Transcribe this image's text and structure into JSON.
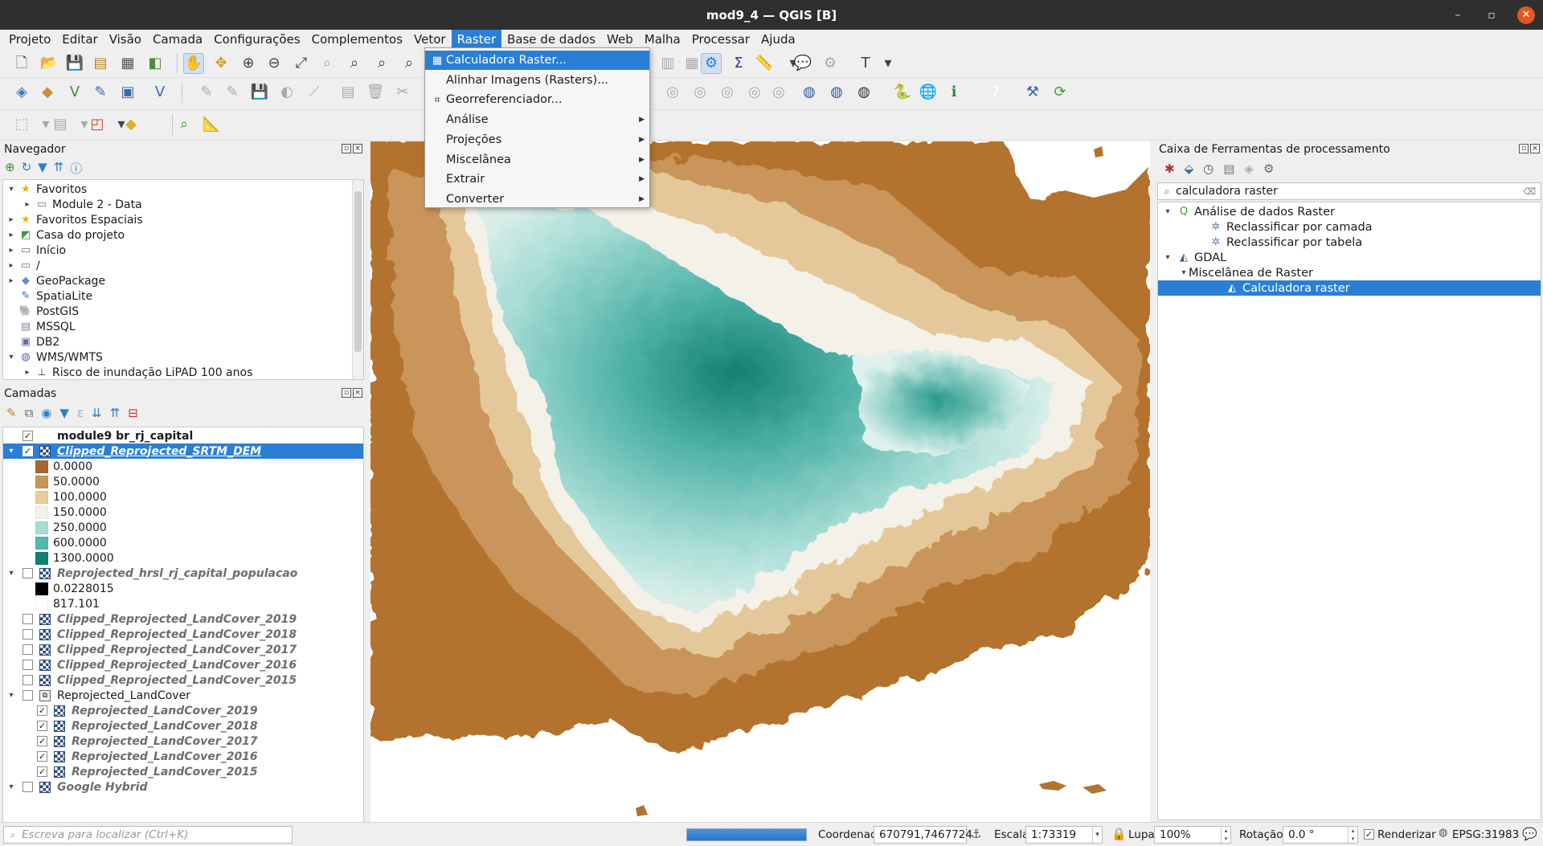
{
  "window": {
    "title": "mod9_4 — QGIS [B]",
    "minimize": "–",
    "maximize": "▫",
    "close": "✕"
  },
  "menubar": [
    "Projeto",
    "Editar",
    "Visão",
    "Camada",
    "Configurações",
    "Complementos",
    "Vetor",
    "Raster",
    "Base de dados",
    "Web",
    "Malha",
    "Processar",
    "Ajuda"
  ],
  "active_menu": "Raster",
  "raster_menu": [
    {
      "label": "Calculadora Raster...",
      "icon": "calculator-icon",
      "glyph": "▦",
      "submenu": false
    },
    {
      "label": "Alinhar Imagens (Rasters)...",
      "icon": "",
      "glyph": "",
      "submenu": false
    },
    {
      "label": "Georreferenciador...",
      "icon": "georeferencer-icon",
      "glyph": "⌗",
      "submenu": false
    },
    {
      "label": "Análise",
      "icon": "",
      "glyph": "",
      "submenu": true
    },
    {
      "label": "Projeções",
      "icon": "",
      "glyph": "",
      "submenu": true
    },
    {
      "label": "Miscelânea",
      "icon": "",
      "glyph": "",
      "submenu": true
    },
    {
      "label": "Extrair",
      "icon": "",
      "glyph": "",
      "submenu": true
    },
    {
      "label": "Converter",
      "icon": "",
      "glyph": "",
      "submenu": true
    }
  ],
  "navigator": {
    "title": "Navegador",
    "items": [
      {
        "label": "Favoritos",
        "caret": "▾",
        "icon": "star-icon",
        "glyph": "★",
        "color": "#e8b400"
      },
      {
        "label": "Module 2 - Data",
        "caret": "▸",
        "icon": "folder-icon",
        "glyph": "▭",
        "color": "#777777",
        "indent": 1
      },
      {
        "label": "Favoritos Espaciais",
        "caret": "▸",
        "icon": "star-icon",
        "glyph": "★",
        "color": "#e8b400"
      },
      {
        "label": "Casa do projeto",
        "caret": "▸",
        "icon": "project-home-icon",
        "glyph": "◩",
        "color": "#3a9b3a"
      },
      {
        "label": "Início",
        "caret": "▸",
        "icon": "folder-icon",
        "glyph": "▭",
        "color": "#777777"
      },
      {
        "label": "/",
        "caret": "▸",
        "icon": "folder-icon",
        "glyph": "▭",
        "color": "#777777"
      },
      {
        "label": "GeoPackage",
        "caret": "▸",
        "icon": "geopackage-icon",
        "glyph": "◆",
        "color": "#5f8fd1"
      },
      {
        "label": "SpatiaLite",
        "caret": "",
        "icon": "spatialite-icon",
        "glyph": "✎",
        "color": "#3466b5"
      },
      {
        "label": "PostGIS",
        "caret": "",
        "icon": "postgis-icon",
        "glyph": "🐘",
        "color": "#3b6aa0"
      },
      {
        "label": "MSSQL",
        "caret": "",
        "icon": "mssql-icon",
        "glyph": "▤",
        "color": "#7a8aa0"
      },
      {
        "label": "DB2",
        "caret": "",
        "icon": "db2-icon",
        "glyph": "▣",
        "color": "#5a6f9a"
      },
      {
        "label": "WMS/WMTS",
        "caret": "▾",
        "icon": "globe-icon",
        "glyph": "◍",
        "color": "#4a6ca0"
      },
      {
        "label": "Risco de inundação LiPAD 100 anos",
        "caret": "▸",
        "icon": "wms-layer-icon",
        "glyph": "⟂",
        "color": "#555555",
        "indent": 1
      }
    ]
  },
  "layers": {
    "title": "Camadas",
    "items": [
      {
        "type": "layer",
        "label": "module9 br_rj_capital",
        "checked": true,
        "caret": "",
        "icon": "none",
        "style": "bold",
        "indent": 0
      },
      {
        "type": "layer",
        "label": "Clipped_Reprojected_SRTM_DEM",
        "checked": true,
        "caret": "▾",
        "icon": "raster",
        "style": "it",
        "indent": 0,
        "selected": true
      },
      {
        "type": "legend",
        "label": "0.0000",
        "color": "#a9662a"
      },
      {
        "type": "legend",
        "label": "50.0000",
        "color": "#c69656"
      },
      {
        "type": "legend",
        "label": "100.0000",
        "color": "#e8cc98"
      },
      {
        "type": "legend",
        "label": "150.0000",
        "color": "#f3f1e8"
      },
      {
        "type": "legend",
        "label": "250.0000",
        "color": "#a6dcd5"
      },
      {
        "type": "legend",
        "label": "600.0000",
        "color": "#56b6ab"
      },
      {
        "type": "legend",
        "label": "1300.0000",
        "color": "#128070"
      },
      {
        "type": "layer",
        "label": "Reprojected_hrsl_rj_capital_populacao",
        "checked": false,
        "caret": "▾",
        "icon": "raster",
        "style": "it",
        "indent": 0
      },
      {
        "type": "legend",
        "label": "0.0228015",
        "color": "#000000"
      },
      {
        "type": "legend",
        "label": "817.101",
        "color": "#ffffff"
      },
      {
        "type": "layer",
        "label": "Clipped_Reprojected_LandCover_2019",
        "checked": false,
        "caret": "",
        "icon": "raster",
        "style": "it",
        "indent": 0
      },
      {
        "type": "layer",
        "label": "Clipped_Reprojected_LandCover_2018",
        "checked": false,
        "caret": "",
        "icon": "raster",
        "style": "it",
        "indent": 0
      },
      {
        "type": "layer",
        "label": "Clipped_Reprojected_LandCover_2017",
        "checked": false,
        "caret": "",
        "icon": "raster",
        "style": "it",
        "indent": 0
      },
      {
        "type": "layer",
        "label": "Clipped_Reprojected_LandCover_2016",
        "checked": false,
        "caret": "",
        "icon": "raster",
        "style": "it",
        "indent": 0
      },
      {
        "type": "layer",
        "label": "Clipped_Reprojected_LandCover_2015",
        "checked": false,
        "caret": "",
        "icon": "raster",
        "style": "it",
        "indent": 0
      },
      {
        "type": "layer",
        "label": "Reprojected_LandCover",
        "checked": false,
        "caret": "▾",
        "icon": "group",
        "style": "",
        "indent": 0
      },
      {
        "type": "layer",
        "label": "Reprojected_LandCover_2019",
        "checked": true,
        "caret": "",
        "icon": "raster",
        "style": "it",
        "indent": 1
      },
      {
        "type": "layer",
        "label": "Reprojected_LandCover_2018",
        "checked": true,
        "caret": "",
        "icon": "raster",
        "style": "it",
        "indent": 1
      },
      {
        "type": "layer",
        "label": "Reprojected_LandCover_2017",
        "checked": true,
        "caret": "",
        "icon": "raster",
        "style": "it",
        "indent": 1
      },
      {
        "type": "layer",
        "label": "Reprojected_LandCover_2016",
        "checked": true,
        "caret": "",
        "icon": "raster",
        "style": "it",
        "indent": 1
      },
      {
        "type": "layer",
        "label": "Reprojected_LandCover_2015",
        "checked": true,
        "caret": "",
        "icon": "raster",
        "style": "it",
        "indent": 1
      },
      {
        "type": "layer",
        "label": "Google Hybrid",
        "checked": false,
        "caret": "▾",
        "icon": "raster",
        "style": "it",
        "indent": 0
      }
    ]
  },
  "processing": {
    "title": "Caixa de Ferramentas de processamento",
    "search_value": "calculadora raster",
    "items": [
      {
        "label": "Análise de dados Raster",
        "caret": "▾",
        "icon": "qgis-icon",
        "glyph": "Q",
        "color": "#4a9b2e",
        "indent": 0
      },
      {
        "label": "Reclassificar por camada",
        "caret": "",
        "icon": "gear-icon",
        "glyph": "✲",
        "color": "#5b7fb4",
        "indent": 2
      },
      {
        "label": "Reclassificar por tabela",
        "caret": "",
        "icon": "gear-icon",
        "glyph": "✲",
        "color": "#5b7fb4",
        "indent": 2
      },
      {
        "label": "GDAL",
        "caret": "▾",
        "icon": "gdal-icon",
        "glyph": "◭",
        "color": "#3a5f7a",
        "indent": 0
      },
      {
        "label": "Miscelânea de Raster",
        "caret": "▾",
        "icon": "",
        "glyph": "",
        "color": "#000000",
        "indent": 1
      },
      {
        "label": "Calculadora raster",
        "caret": "",
        "icon": "gdal-icon",
        "glyph": "◭",
        "color": "#e0eefc",
        "indent": 3,
        "selected": true
      }
    ]
  },
  "statusbar": {
    "locator_placeholder": "Escreva para localizar (Ctrl+K)",
    "progress": 1.0,
    "coord_label": "Coordenada",
    "coord_value": "670791,7467724",
    "scale_label": "Escala",
    "scale_value": "1:73319",
    "magnifier_label": "Lupa",
    "magnifier_value": "100%",
    "rotation_label": "Rotação",
    "rotation_value": "0.0 °",
    "render_label": "Renderizar",
    "render_checked": true,
    "crs": "EPSG:31983"
  },
  "colors": {
    "accent": "#2a7fd4",
    "titlebar": "#2f2f2f",
    "close": "#e95420"
  }
}
